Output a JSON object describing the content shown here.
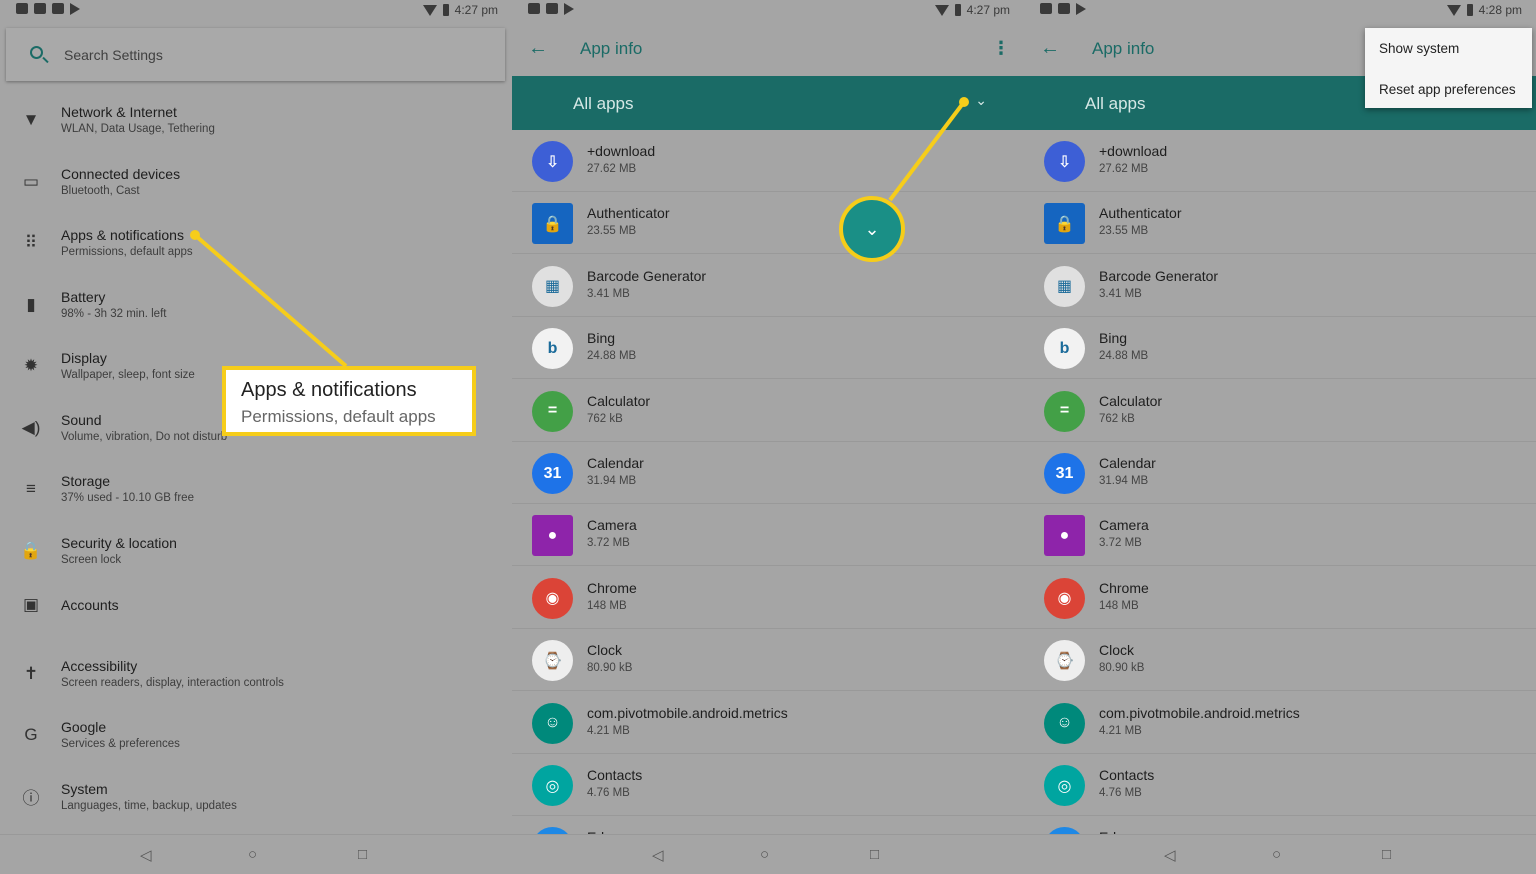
{
  "status": {
    "time_1": "4:27 pm",
    "time_2": "4:27 pm",
    "time_3": "4:28 pm"
  },
  "settings": {
    "search_placeholder": "Search Settings",
    "items": [
      {
        "title": "Network & Internet",
        "subtitle": "WLAN, Data Usage, Tethering",
        "icon": "wifi-icon"
      },
      {
        "title": "Connected devices",
        "subtitle": "Bluetooth, Cast",
        "icon": "devices-icon"
      },
      {
        "title": "Apps & notifications",
        "subtitle": "Permissions, default apps",
        "icon": "apps-icon"
      },
      {
        "title": "Battery",
        "subtitle": "98% - 3h 32 min. left",
        "icon": "battery-icon"
      },
      {
        "title": "Display",
        "subtitle": "Wallpaper, sleep, font size",
        "icon": "display-icon"
      },
      {
        "title": "Sound",
        "subtitle": "Volume, vibration, Do not disturb",
        "icon": "sound-icon"
      },
      {
        "title": "Storage",
        "subtitle": "37% used - 10.10 GB free",
        "icon": "storage-icon"
      },
      {
        "title": "Security & location",
        "subtitle": "Screen lock",
        "icon": "lock-icon"
      },
      {
        "title": "Accounts",
        "subtitle": "",
        "icon": "accounts-icon"
      },
      {
        "title": "Accessibility",
        "subtitle": "Screen readers, display, interaction controls",
        "icon": "accessibility-icon"
      },
      {
        "title": "Google",
        "subtitle": "Services & preferences",
        "icon": "google-icon"
      },
      {
        "title": "System",
        "subtitle": "Languages, time, backup, updates",
        "icon": "info-icon"
      }
    ]
  },
  "callout": {
    "title": "Apps & notifications",
    "subtitle": "Permissions, default apps"
  },
  "appinfo": {
    "title": "App info",
    "filter": "All apps",
    "apps": [
      {
        "name": "+download",
        "size": "27.62 MB",
        "color": "#3d5fd6"
      },
      {
        "name": "Authenticator",
        "size": "23.55 MB",
        "color": "#1565c0"
      },
      {
        "name": "Barcode Generator",
        "size": "3.41 MB",
        "color": "#e0e0e0"
      },
      {
        "name": "Bing",
        "size": "24.88 MB",
        "color": "#f2f2f2"
      },
      {
        "name": "Calculator",
        "size": "762 kB",
        "color": "#43a047"
      },
      {
        "name": "Calendar",
        "size": "31.94 MB",
        "color": "#1e73e8"
      },
      {
        "name": "Camera",
        "size": "3.72 MB",
        "color": "#8e24aa"
      },
      {
        "name": "Chrome",
        "size": "148 MB",
        "color": "#db4437"
      },
      {
        "name": "Clock",
        "size": "80.90 kB",
        "color": "#eeeeee"
      },
      {
        "name": "com.pivotmobile.android.metrics",
        "size": "4.21 MB",
        "color": "#00897b"
      },
      {
        "name": "Contacts",
        "size": "4.76 MB",
        "color": "#00a5a0"
      },
      {
        "name": "Edge",
        "size": "",
        "color": "#1e88e5"
      }
    ]
  },
  "menu": {
    "items": [
      "Show system",
      "Reset app preferences"
    ]
  },
  "colors": {
    "teal": "#1a6b66",
    "highlight": "#f6cd1a"
  }
}
